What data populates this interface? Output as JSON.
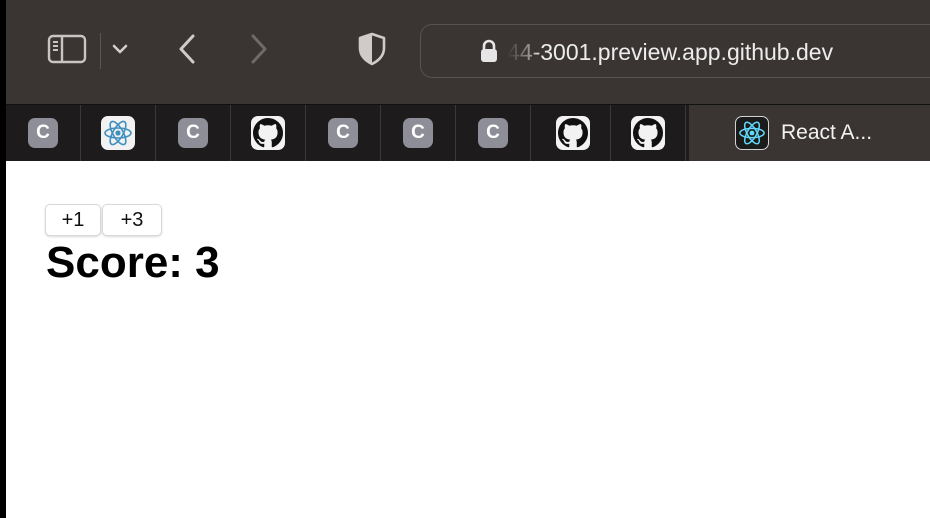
{
  "browser": {
    "url_display": "44-3001.preview.app.github.dev",
    "icons": {
      "sidebar": "sidebar-icon",
      "dropdown": "chevron-down-icon",
      "back": "chevron-left-icon",
      "forward": "chevron-right-icon",
      "privacy": "shield-icon",
      "lock": "lock-icon"
    },
    "colors": {
      "toolbar": "#3a3533",
      "tabbar": "#1d1b1b",
      "favicon_c": "#8e8e98"
    }
  },
  "tabs": [
    {
      "favicon": "c-icon",
      "letter": "C"
    },
    {
      "favicon": "react-icon"
    },
    {
      "favicon": "c-icon",
      "letter": "C"
    },
    {
      "favicon": "github-icon"
    },
    {
      "favicon": "c-icon",
      "letter": "C"
    },
    {
      "favicon": "c-icon",
      "letter": "C"
    },
    {
      "favicon": "c-icon",
      "letter": "C"
    },
    {
      "favicon": "github-icon"
    },
    {
      "favicon": "github-icon"
    }
  ],
  "active_tab": {
    "favicon": "react-icon",
    "title": "React A..."
  },
  "page": {
    "buttons": [
      {
        "label": "+1"
      },
      {
        "label": "+3"
      }
    ],
    "score_text": "Score: 3"
  }
}
